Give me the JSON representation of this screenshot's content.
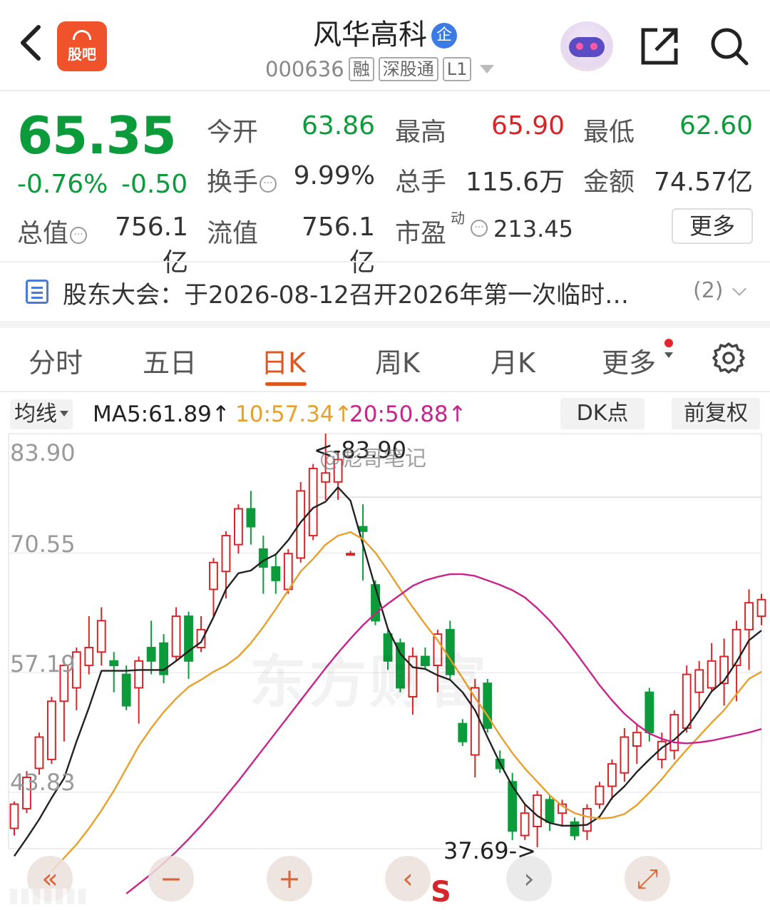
{
  "header": {
    "app_logo_text": "股吧",
    "stock_name": "风华高科",
    "name_badge": "企",
    "code": "000636",
    "tags": [
      "融",
      "深股通",
      "L1"
    ]
  },
  "quote": {
    "price": "65.35",
    "change_pct": "-0.76%",
    "change_abs": "-0.50",
    "open_label": "今开",
    "open": "63.86",
    "high_label": "最高",
    "high": "65.90",
    "low_label": "最低",
    "low": "62.60",
    "turnover_label": "换手",
    "turnover": "9.99%",
    "volume_label": "总手",
    "volume": "115.6万",
    "amount_label": "金额",
    "amount": "74.57亿",
    "total_value_label": "总值",
    "total_value": "756.1亿",
    "float_value_label": "流值",
    "float_value": "756.1亿",
    "pe_label": "市盈",
    "pe_sup": "动",
    "pe": "213.45",
    "more_label": "更多"
  },
  "notice": {
    "text": "股东大会：于2026-08-12召开2026年第一次临时…",
    "count": "(2)"
  },
  "tabs": [
    {
      "label": "分时",
      "active": false
    },
    {
      "label": "五日",
      "active": false
    },
    {
      "label": "日K",
      "active": true
    },
    {
      "label": "周K",
      "active": false
    },
    {
      "label": "月K",
      "active": false
    },
    {
      "label": "更多",
      "active": false
    }
  ],
  "indicator_bar": {
    "ma_selector": "均线",
    "ma5": "MA5:61.89↑",
    "ma10": "10:57.34↑",
    "ma20": "20:50.88↑",
    "dk_label": "DK点",
    "adjust_label": "前复权"
  },
  "colors": {
    "up": "#d7262a",
    "down": "#0c9b3a",
    "ma5": "#222222",
    "ma10": "#e8a02a",
    "ma20": "#c8258c",
    "accent": "#e0561f"
  },
  "chart_labels": {
    "high_marker": "<-83.90",
    "low_marker": "37.69->",
    "weibo_watermark": "@彪哥笔记",
    "watermark": "东方财富"
  },
  "bottom_controls": {
    "s_marker": "S"
  },
  "chart_data": {
    "type": "candlestick",
    "ylim": [
      37.69,
      83.9
    ],
    "y_ticks": [
      "83.90",
      "70.55",
      "57.19",
      "43.83"
    ],
    "candles": [
      {
        "o": 39.8,
        "h": 42.8,
        "l": 39.0,
        "c": 42.5
      },
      {
        "o": 42.0,
        "h": 46.2,
        "l": 41.5,
        "c": 45.5
      },
      {
        "o": 46.5,
        "h": 50.5,
        "l": 45.8,
        "c": 50.0
      },
      {
        "o": 47.5,
        "h": 54.5,
        "l": 47.0,
        "c": 54.0
      },
      {
        "o": 54.0,
        "h": 58.5,
        "l": 49.5,
        "c": 58.0
      },
      {
        "o": 55.5,
        "h": 60.0,
        "l": 53.0,
        "c": 59.5
      },
      {
        "o": 58.0,
        "h": 63.5,
        "l": 57.0,
        "c": 60.0
      },
      {
        "o": 59.5,
        "h": 64.5,
        "l": 58.0,
        "c": 63.0
      },
      {
        "o": 58.5,
        "h": 59.5,
        "l": 55.0,
        "c": 58.0
      },
      {
        "o": 57.0,
        "h": 58.0,
        "l": 53.0,
        "c": 53.5
      },
      {
        "o": 55.5,
        "h": 59.0,
        "l": 51.5,
        "c": 58.5
      },
      {
        "o": 60.0,
        "h": 63.0,
        "l": 57.0,
        "c": 58.5
      },
      {
        "o": 60.5,
        "h": 61.5,
        "l": 56.0,
        "c": 57.0
      },
      {
        "o": 59.0,
        "h": 64.5,
        "l": 58.5,
        "c": 63.5
      },
      {
        "o": 63.5,
        "h": 64.0,
        "l": 56.5,
        "c": 58.5
      },
      {
        "o": 60.0,
        "h": 63.5,
        "l": 59.5,
        "c": 62.0
      },
      {
        "o": 66.5,
        "h": 70.0,
        "l": 63.5,
        "c": 69.5
      },
      {
        "o": 68.5,
        "h": 73.0,
        "l": 65.5,
        "c": 72.5
      },
      {
        "o": 71.5,
        "h": 76.0,
        "l": 70.5,
        "c": 75.5
      },
      {
        "o": 75.5,
        "h": 77.5,
        "l": 71.5,
        "c": 73.5
      },
      {
        "o": 71.0,
        "h": 72.5,
        "l": 66.0,
        "c": 69.0
      },
      {
        "o": 69.0,
        "h": 70.5,
        "l": 66.0,
        "c": 67.5
      },
      {
        "o": 66.5,
        "h": 71.0,
        "l": 66.0,
        "c": 70.5
      },
      {
        "o": 70.0,
        "h": 78.5,
        "l": 69.5,
        "c": 77.5
      },
      {
        "o": 72.5,
        "h": 80.5,
        "l": 72.0,
        "c": 80.0
      },
      {
        "o": 78.5,
        "h": 83.9,
        "l": 76.5,
        "c": 79.5
      },
      {
        "o": 78.5,
        "h": 82.0,
        "l": 76.5,
        "c": 81.0
      },
      {
        "o": 70.5,
        "h": 70.8,
        "l": 70.3,
        "c": 70.5
      },
      {
        "o": 73.5,
        "h": 76.0,
        "l": 67.5,
        "c": 73.0
      },
      {
        "o": 67.0,
        "h": 67.5,
        "l": 62.5,
        "c": 63.0
      },
      {
        "o": 61.5,
        "h": 62.0,
        "l": 57.5,
        "c": 58.5
      },
      {
        "o": 60.5,
        "h": 61.0,
        "l": 55.0,
        "c": 55.5
      },
      {
        "o": 54.5,
        "h": 60.0,
        "l": 52.5,
        "c": 59.0
      },
      {
        "o": 59.0,
        "h": 60.0,
        "l": 57.5,
        "c": 58.0
      },
      {
        "o": 58.0,
        "h": 62.0,
        "l": 55.0,
        "c": 61.5
      },
      {
        "o": 62.0,
        "h": 63.0,
        "l": 56.5,
        "c": 57.0
      },
      {
        "o": 51.5,
        "h": 52.0,
        "l": 49.0,
        "c": 49.5
      },
      {
        "o": 48.0,
        "h": 56.5,
        "l": 45.5,
        "c": 55.5
      },
      {
        "o": 56.0,
        "h": 56.5,
        "l": 50.5,
        "c": 51.0
      },
      {
        "o": 47.5,
        "h": 48.5,
        "l": 46.0,
        "c": 46.5
      },
      {
        "o": 45.0,
        "h": 46.0,
        "l": 38.5,
        "c": 39.5
      },
      {
        "o": 39.0,
        "h": 42.5,
        "l": 38.5,
        "c": 41.5
      },
      {
        "o": 40.0,
        "h": 44.0,
        "l": 37.69,
        "c": 43.5
      },
      {
        "o": 43.0,
        "h": 43.5,
        "l": 39.5,
        "c": 40.5
      },
      {
        "o": 41.5,
        "h": 43.0,
        "l": 40.0,
        "c": 42.5
      },
      {
        "o": 40.5,
        "h": 41.0,
        "l": 38.5,
        "c": 39.0
      },
      {
        "o": 39.5,
        "h": 42.5,
        "l": 38.5,
        "c": 42.0
      },
      {
        "o": 42.5,
        "h": 45.0,
        "l": 42.0,
        "c": 44.5
      },
      {
        "o": 44.5,
        "h": 47.5,
        "l": 43.0,
        "c": 47.0
      },
      {
        "o": 46.0,
        "h": 51.0,
        "l": 45.0,
        "c": 50.0
      },
      {
        "o": 49.0,
        "h": 51.5,
        "l": 47.0,
        "c": 50.5
      },
      {
        "o": 55.0,
        "h": 55.5,
        "l": 49.5,
        "c": 50.5
      },
      {
        "o": 47.5,
        "h": 50.5,
        "l": 46.5,
        "c": 49.5
      },
      {
        "o": 48.5,
        "h": 53.0,
        "l": 47.5,
        "c": 52.5
      },
      {
        "o": 51.0,
        "h": 58.0,
        "l": 50.5,
        "c": 57.0
      },
      {
        "o": 55.0,
        "h": 58.5,
        "l": 53.0,
        "c": 57.5
      },
      {
        "o": 55.5,
        "h": 60.5,
        "l": 55.0,
        "c": 58.5
      },
      {
        "o": 56.0,
        "h": 61.0,
        "l": 53.5,
        "c": 59.0
      },
      {
        "o": 58.0,
        "h": 63.0,
        "l": 54.0,
        "c": 62.0
      },
      {
        "o": 62.0,
        "h": 66.5,
        "l": 57.5,
        "c": 65.0
      },
      {
        "o": 63.5,
        "h": 66.0,
        "l": 62.5,
        "c": 65.35
      }
    ],
    "ma_series": [
      {
        "name": "MA5",
        "values": [
          36.7,
          38.7,
          40.8,
          43.2,
          45.4,
          49.5,
          53.3,
          57.4,
          57.4,
          57.4,
          57.5,
          57.5,
          57.5,
          58.5,
          59.6,
          60.6,
          63.4,
          66.5,
          68.3,
          68.6,
          69.7,
          70.4,
          72.0,
          74.0,
          75.6,
          76.3,
          77.9,
          76.4,
          71.5,
          66.7,
          62.1,
          59.3,
          57.8,
          57.6,
          56.9,
          56.4,
          55.0,
          53.0,
          50.0,
          47.1,
          44.5,
          42.5,
          41.2,
          40.4,
          40.1,
          40.1,
          40.2,
          41.1,
          43.2,
          44.5,
          46.1,
          47.5,
          48.8,
          49.7,
          51.0,
          53.0,
          55.1,
          56.3,
          58.4,
          60.8,
          61.9
        ]
      },
      {
        "name": "MA10",
        "values": [
          35.0,
          36.5,
          38.0,
          39.8,
          41.8,
          44.0,
          46.5,
          49.0,
          51.0,
          52.8,
          54.3,
          55.6,
          56.4,
          57.3,
          58.0,
          59.0,
          60.5,
          62.3,
          64.3,
          66.4,
          68.5,
          69.9,
          71.5,
          72.5,
          72.9,
          72.1,
          70.6,
          68.6,
          66.5,
          64.5,
          62.6,
          60.8,
          58.7,
          56.6,
          54.4,
          52.4,
          50.2,
          48.2,
          46.5,
          45.0,
          43.5,
          42.3,
          41.5,
          41.1,
          40.9,
          41.0,
          41.4,
          42.4,
          43.8,
          45.3,
          47.0,
          48.6,
          50.1,
          51.6,
          53.0,
          54.8,
          56.5,
          57.3
        ]
      },
      {
        "name": "MA20",
        "values": [
          32.5,
          33.6,
          34.7,
          35.9,
          37.2,
          38.6,
          40.1,
          41.7,
          43.4,
          45.1,
          46.9,
          48.7,
          50.5,
          52.3,
          54.1,
          55.9,
          57.7,
          59.4,
          61.0,
          62.5,
          63.8,
          64.9,
          65.9,
          66.9,
          67.5,
          67.9,
          68.2,
          68.2,
          68.0,
          67.5,
          67.0,
          66.4,
          65.6,
          64.4,
          63.0,
          61.4,
          59.6,
          57.7,
          55.8,
          54.1,
          52.6,
          51.4,
          50.4,
          49.8,
          49.4,
          49.3,
          49.4,
          49.6,
          49.9,
          50.2,
          50.5,
          50.9
        ]
      }
    ]
  }
}
